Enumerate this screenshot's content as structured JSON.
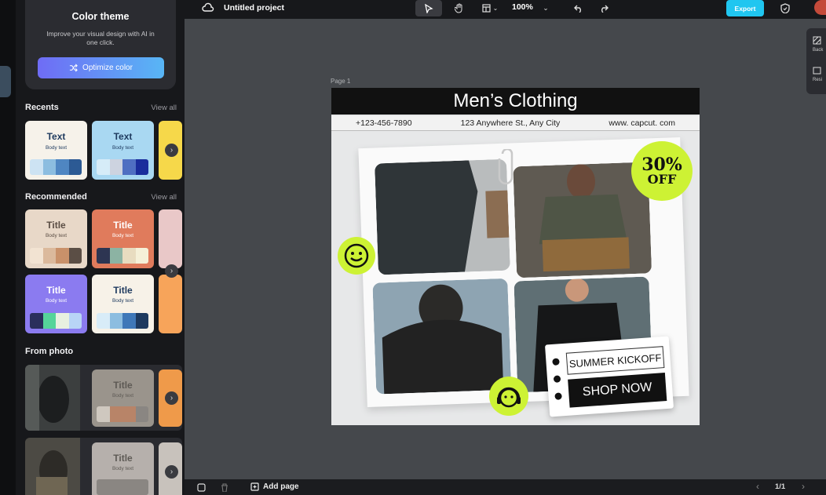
{
  "panel": {
    "theme_title": "Color theme",
    "theme_desc": "Improve your visual design with AI in one click.",
    "optimize_label": "Optimize color",
    "recents_title": "Recents",
    "recommended_title": "Recommended",
    "from_photo_title": "From photo",
    "view_all": "View all",
    "recents": [
      {
        "title": "Text",
        "body": "Body text",
        "bg": "#f6f2ea",
        "tc": "#1e3a5f",
        "swatches": [
          "#cde3f3",
          "#8cbde0",
          "#4f86c2",
          "#2c5a94"
        ]
      },
      {
        "title": "Text",
        "body": "Body text",
        "bg": "#a9d8f2",
        "tc": "#1e3a5f",
        "swatches": [
          "#d6ecf8",
          "#cdd3e0",
          "#4f6fc2",
          "#1a2d9c"
        ]
      }
    ],
    "recommended": [
      {
        "title": "Title",
        "body": "Body text",
        "bg": "#e8d8c8",
        "tc": "#5b4e45",
        "swatches": [
          "#f2e3d2",
          "#dbb99c",
          "#c9916a",
          "#5b4e45"
        ]
      },
      {
        "title": "Title",
        "body": "Body text",
        "bg": "#e07b5c",
        "tc": "#fff",
        "swatches": [
          "#2d3552",
          "#8cb3a3",
          "#e8dcc0",
          "#f5f0d8"
        ]
      },
      {
        "title": "Title",
        "body": "Body text",
        "bg": "#8b7bf0",
        "tc": "#fff",
        "swatches": [
          "#2a2f5c",
          "#55d49a",
          "#e8f0e0",
          "#b8d4f6"
        ]
      },
      {
        "title": "Title",
        "body": "Body text",
        "bg": "#f7f2e8",
        "tc": "#1e3a5f",
        "swatches": [
          "#d8ecf8",
          "#8cbde0",
          "#3f78b8",
          "#1e3a5f"
        ]
      }
    ],
    "from_photo": [
      {
        "title": "Title",
        "body": "Body text",
        "bg": "#9a948c",
        "tc": "#5e5a55",
        "swatches": [
          "#cfc8bf",
          "#b88468",
          "#b88468",
          "#8a8682"
        ]
      },
      {
        "title": "Title",
        "body": "Body text",
        "bg": "#b6b0ac",
        "tc": "#5e5a55",
        "swatches": [
          "#8a8682",
          "#8a8682",
          "#8a8682",
          "#8a8682"
        ]
      }
    ]
  },
  "topbar": {
    "project_title": "Untitled project",
    "zoom": "100%",
    "export_label": "Export"
  },
  "canvas": {
    "page_label": "Page 1",
    "right_tools": [
      "Back",
      "Resi"
    ]
  },
  "design": {
    "heading": "Men’s Clothing",
    "phone": "+123-456-7890",
    "address": "123 Anywhere St., Any City",
    "website": "www. capcut. com",
    "discount_pct": "30%",
    "discount_off": "OFF",
    "kickoff": "SUMMER KICKOFF",
    "shop_now": "SHOP NOW"
  },
  "bottombar": {
    "add_page": "Add page",
    "page_indicator": "1/1"
  },
  "colors": {
    "accent": "#20c6f0",
    "badge": "#cdf234",
    "optimize_gradient": [
      "#6f6cf5",
      "#58b6f5"
    ]
  }
}
